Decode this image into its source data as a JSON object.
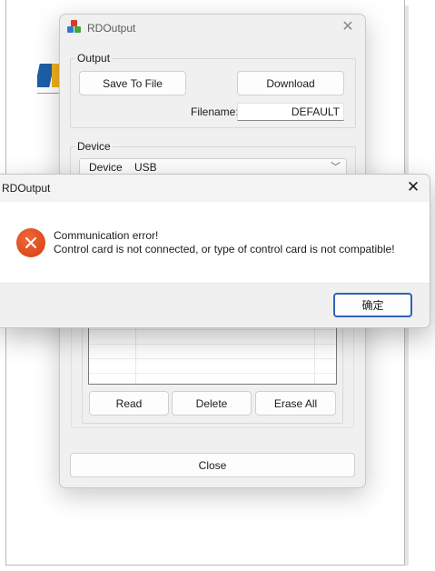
{
  "main_window": {
    "title": "RDOutput",
    "output_group": {
      "label": "Output",
      "save_to_file": "Save To File",
      "download": "Download",
      "filename_label": "Filename:",
      "filename_value": "DEFAULT"
    },
    "device_group": {
      "label": "Device",
      "device_select": "Device    USB"
    },
    "file_buttons": {
      "read": "Read",
      "delete": "Delete",
      "erase_all": "Erase All"
    },
    "close_button": "Close"
  },
  "message_box": {
    "title": "RDOutput",
    "line1": "Communication error!",
    "line2": "Control card is not connected, or type of control card is not compatible!",
    "ok_button": "确定",
    "icon": "error-icon",
    "icon_color": "#dd4a1d",
    "accent_color": "#2f62b8"
  }
}
